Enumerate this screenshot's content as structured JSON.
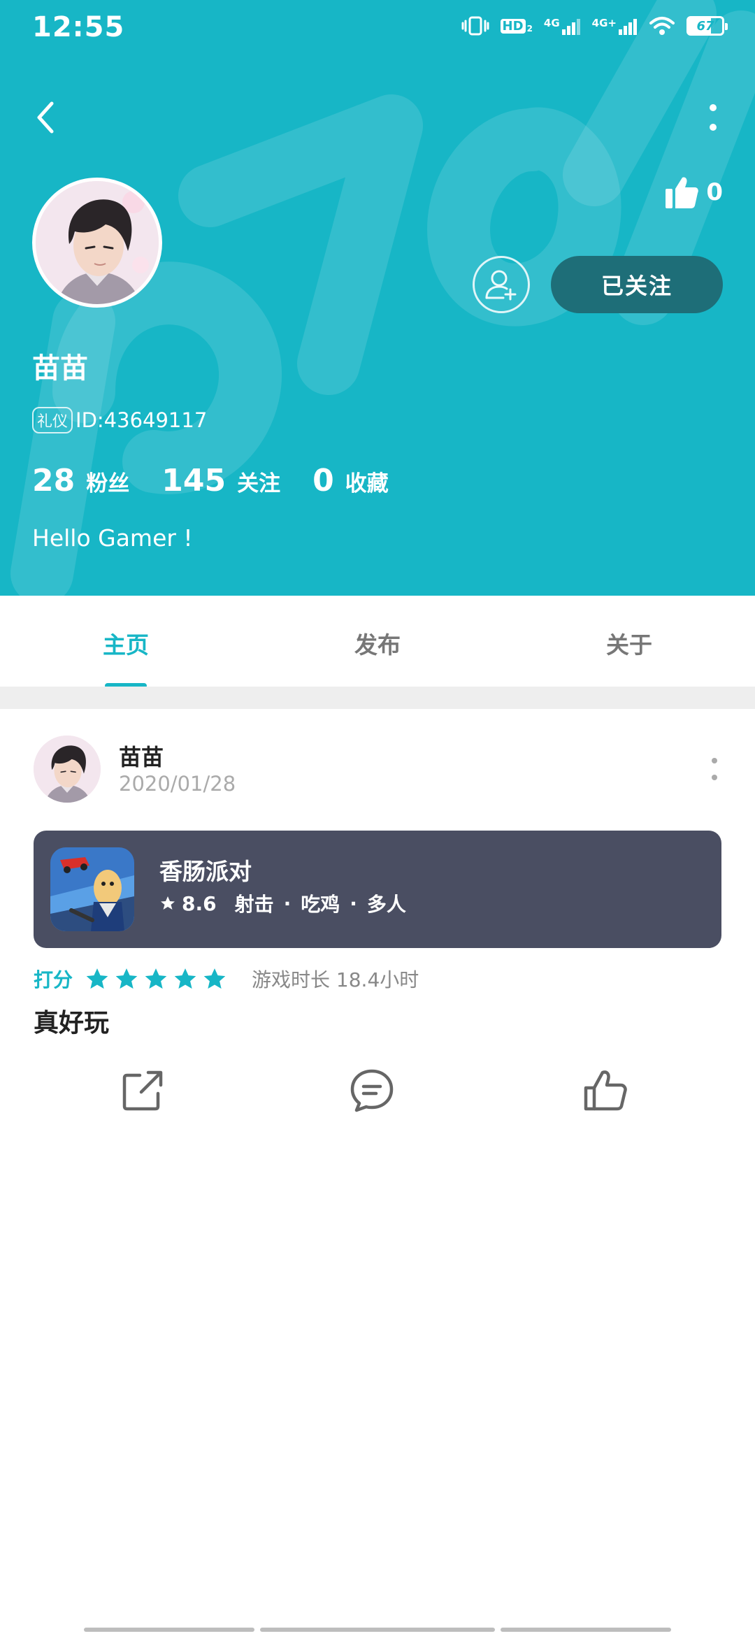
{
  "status_bar": {
    "time": "12:55",
    "hd_label": "HD",
    "signal1_label": "4G",
    "signal2_label": "4G+",
    "battery": "67"
  },
  "profile": {
    "like_count": "0",
    "follow_button": "已关注",
    "name": "苗苗",
    "etiquette_badge": "礼仪",
    "id_text": "ID:43649117",
    "stats": [
      {
        "num": "28",
        "label": "粉丝"
      },
      {
        "num": "145",
        "label": "关注"
      },
      {
        "num": "0",
        "label": "收藏"
      }
    ],
    "bio": "Hello Gamer !"
  },
  "tabs": [
    {
      "label": "主页",
      "active": true
    },
    {
      "label": "发布",
      "active": false
    },
    {
      "label": "关于",
      "active": false
    }
  ],
  "post": {
    "author": "苗苗",
    "date": "2020/01/28",
    "game": {
      "name": "香肠派对",
      "score": "8.6",
      "tags": [
        "射击",
        "吃鸡",
        "多人"
      ],
      "separator": "·"
    },
    "rating_label": "打分",
    "rating_stars": 5,
    "playtime": "游戏时长 18.4小时",
    "review": "真好玩"
  },
  "colors": {
    "accent": "#17b6c6",
    "follow_button_bg": "#1e6e78",
    "game_card_bg": "#4a4e62"
  },
  "icons": {
    "back": "chevron-left-icon",
    "more": "more-vertical-icon",
    "like": "thumbs-up-icon",
    "add_friend": "add-user-icon",
    "share": "share-icon",
    "comment": "comment-icon",
    "thumb": "thumbs-up-outline-icon",
    "star": "star-icon"
  }
}
